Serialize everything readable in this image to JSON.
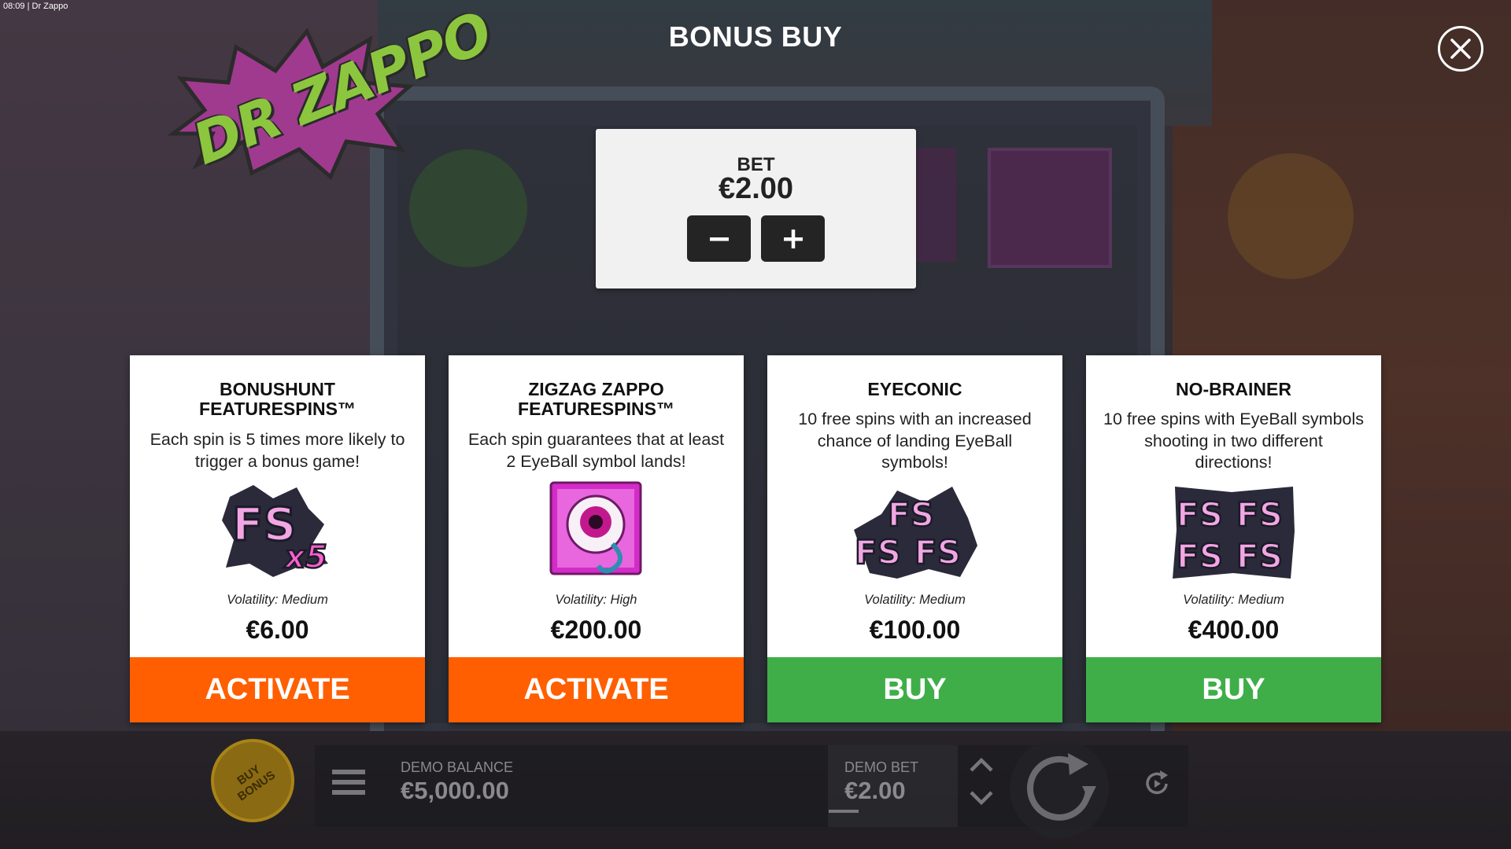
{
  "status_bar": {
    "time": "08:09",
    "app_name": "Dr Zappo",
    "separator": "|"
  },
  "game": {
    "logo_text": "DR ZAPPO"
  },
  "header": {
    "title": "BONUS BUY"
  },
  "close_icon": "close-icon",
  "bet": {
    "label": "BET",
    "value": "€2.00",
    "minus_symbol": "−",
    "plus_symbol": "+"
  },
  "cards": [
    {
      "title_line1": "BONUSHUNT",
      "title_line2": "FEATURESPINS™",
      "desc_lines": [
        "Each spin is 5 times more likely to",
        "trigger a bonus game!"
      ],
      "art": "fs-x5-icon",
      "volatility": "Volatility: Medium",
      "price": "€6.00",
      "button": "ACTIVATE",
      "button_color": "#ff5f00"
    },
    {
      "title_line1": "ZIGZAG ZAPPO",
      "title_line2": "FEATURESPINS™",
      "desc_lines": [
        "Each spin guarantees that at least",
        "2 EyeBall symbol lands!"
      ],
      "art": "eyeball-icon",
      "volatility": "Volatility: High",
      "price": "€200.00",
      "button": "ACTIVATE",
      "button_color": "#ff5f00"
    },
    {
      "title_line1": "EYECONIC",
      "title_line2": "",
      "desc_lines": [
        "10 free spins with an increased",
        "chance of landing EyeBall",
        "symbols!"
      ],
      "art": "fs-triple-icon",
      "volatility": "Volatility: Medium",
      "price": "€100.00",
      "button": "BUY",
      "button_color": "#3fae49"
    },
    {
      "title_line1": "NO-BRAINER",
      "title_line2": "",
      "desc_lines": [
        "10 free spins with EyeBall symbols",
        "shooting in two different",
        "directions!"
      ],
      "art": "fs-quad-icon",
      "volatility": "Volatility: Medium",
      "price": "€400.00",
      "button": "BUY",
      "button_color": "#3fae49"
    }
  ],
  "bottom_bar": {
    "buy_bonus_line1": "BUY",
    "buy_bonus_line2": "BONUS",
    "balance_label": "DEMO BALANCE",
    "balance_value": "€5,000.00",
    "bet_label": "DEMO BET",
    "bet_value": "€2.00",
    "icons": [
      "menu-icon",
      "bet-up-icon",
      "bet-down-icon",
      "spin-icon",
      "autoplay-icon"
    ]
  }
}
